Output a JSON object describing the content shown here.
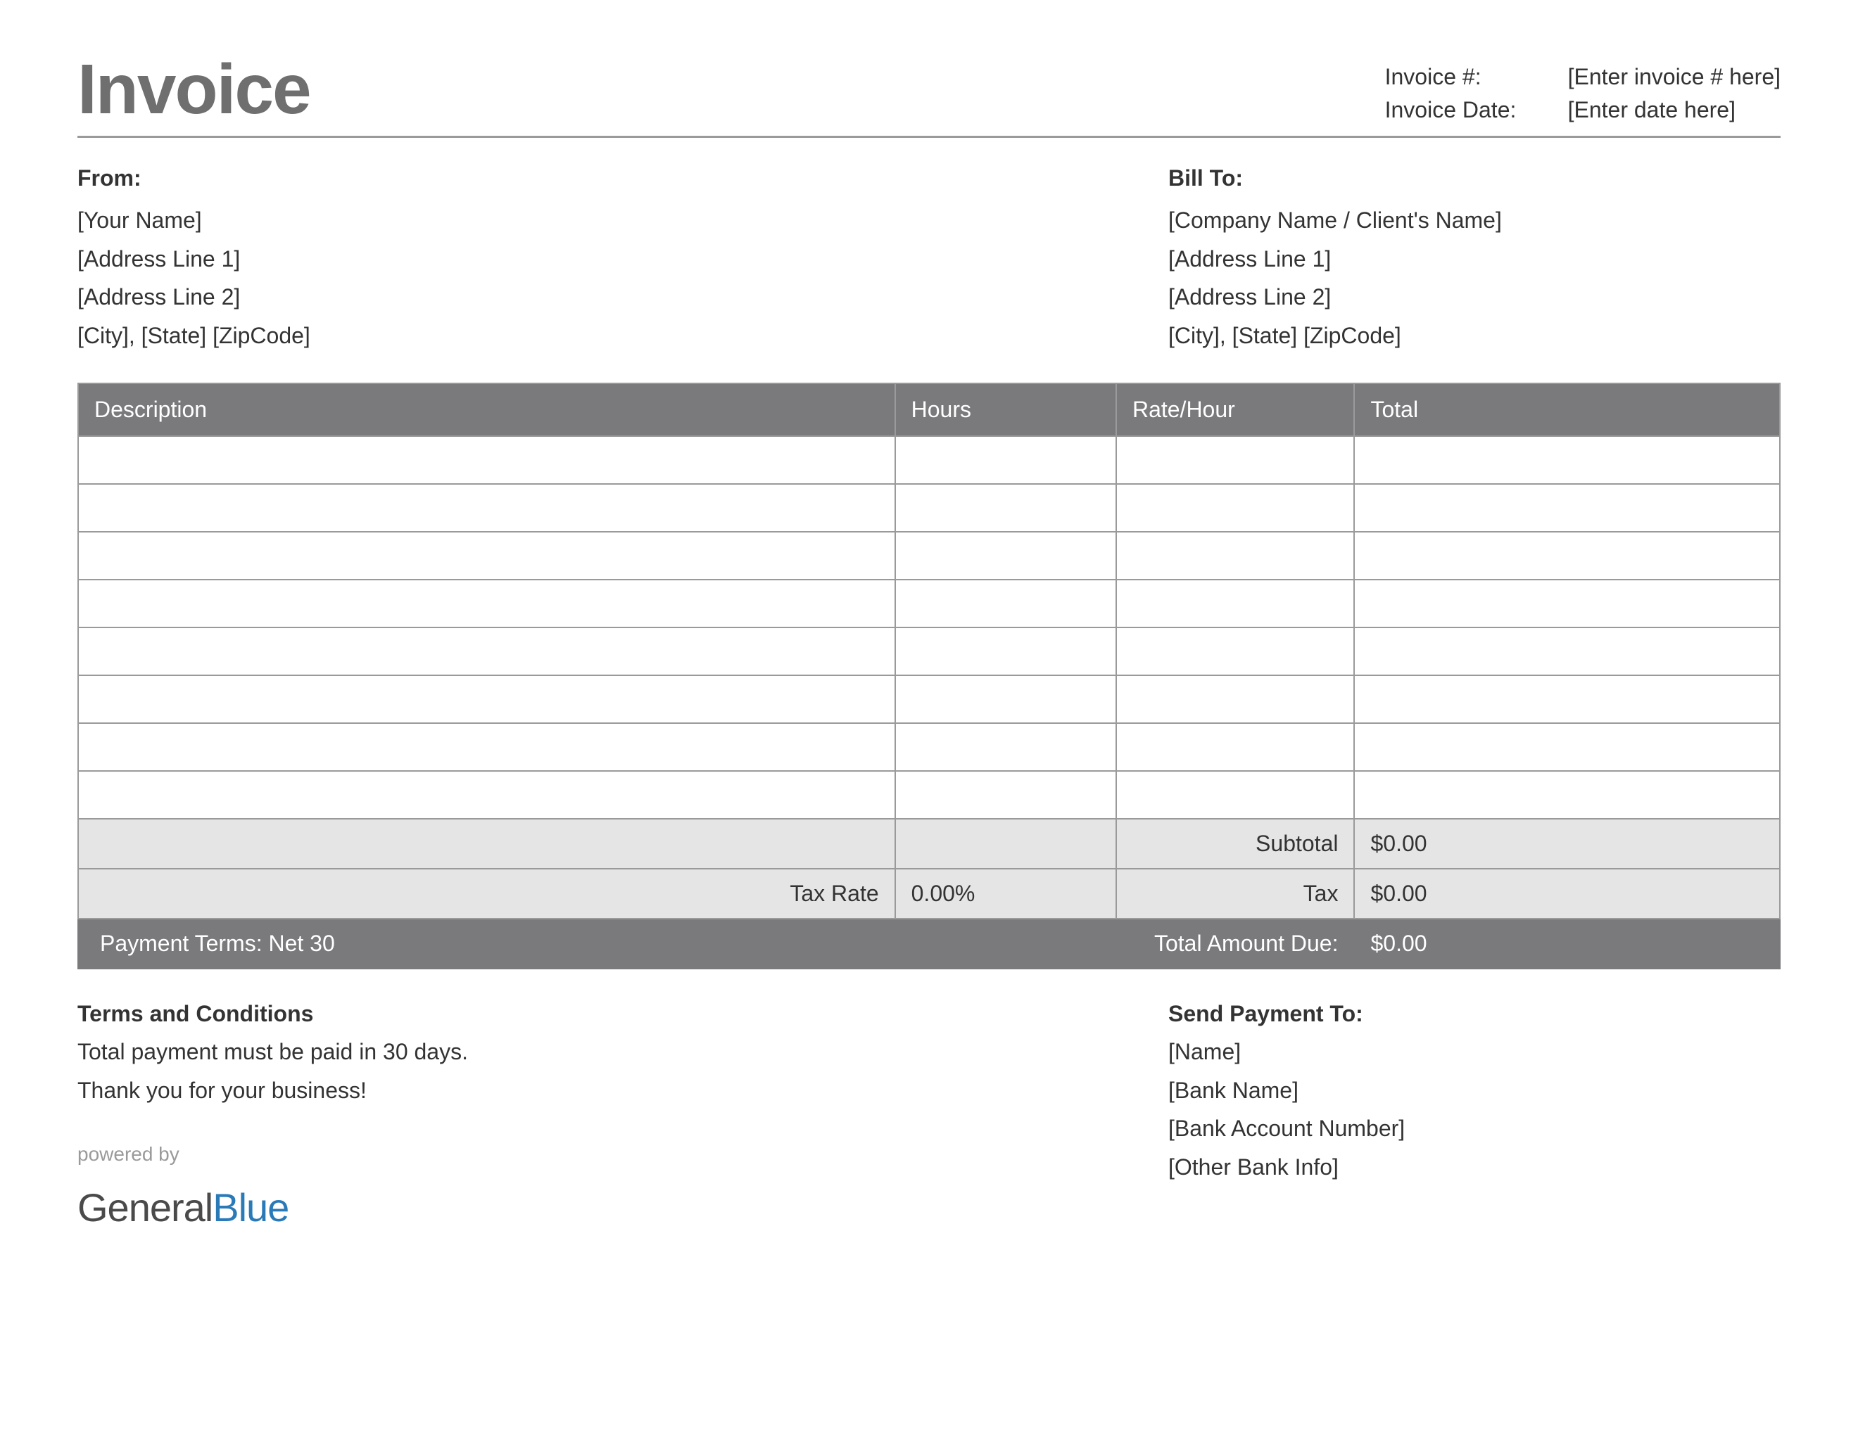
{
  "title": "Invoice",
  "meta": {
    "invoice_number_label": "Invoice #:",
    "invoice_number_value": "[Enter invoice # here]",
    "invoice_date_label": "Invoice Date:",
    "invoice_date_value": "[Enter date here]"
  },
  "from": {
    "heading": "From:",
    "name": "[Your Name]",
    "address1": "[Address Line 1]",
    "address2": "[Address Line 2]",
    "city_state_zip": "[City], [State] [ZipCode]"
  },
  "bill_to": {
    "heading": "Bill To:",
    "name": "[Company Name / Client's Name]",
    "address1": "[Address Line 1]",
    "address2": "[Address Line 2]",
    "city_state_zip": "[City], [State] [ZipCode]"
  },
  "table": {
    "headers": {
      "description": "Description",
      "hours": "Hours",
      "rate": "Rate/Hour",
      "total": "Total"
    },
    "rows": [
      {
        "description": "",
        "hours": "",
        "rate": "",
        "total": ""
      },
      {
        "description": "",
        "hours": "",
        "rate": "",
        "total": ""
      },
      {
        "description": "",
        "hours": "",
        "rate": "",
        "total": ""
      },
      {
        "description": "",
        "hours": "",
        "rate": "",
        "total": ""
      },
      {
        "description": "",
        "hours": "",
        "rate": "",
        "total": ""
      },
      {
        "description": "",
        "hours": "",
        "rate": "",
        "total": ""
      },
      {
        "description": "",
        "hours": "",
        "rate": "",
        "total": ""
      },
      {
        "description": "",
        "hours": "",
        "rate": "",
        "total": ""
      }
    ],
    "subtotal_label": "Subtotal",
    "subtotal_value": "$0.00",
    "tax_rate_label": "Tax Rate",
    "tax_rate_value": "0.00%",
    "tax_label": "Tax",
    "tax_value": "$0.00",
    "payment_terms": "Payment Terms: Net 30",
    "total_due_label": "Total Amount Due:",
    "total_due_value": "$0.00"
  },
  "terms": {
    "heading": "Terms and Conditions",
    "line1": "Total payment must be paid in 30 days.",
    "line2": "Thank you for your business!"
  },
  "payment": {
    "heading": "Send Payment To:",
    "name": "[Name]",
    "bank_name": "[Bank Name]",
    "account_number": "[Bank Account Number]",
    "other": "[Other Bank Info]"
  },
  "powered_by": "powered by",
  "logo": {
    "part1": "General",
    "part2": "Blue"
  }
}
